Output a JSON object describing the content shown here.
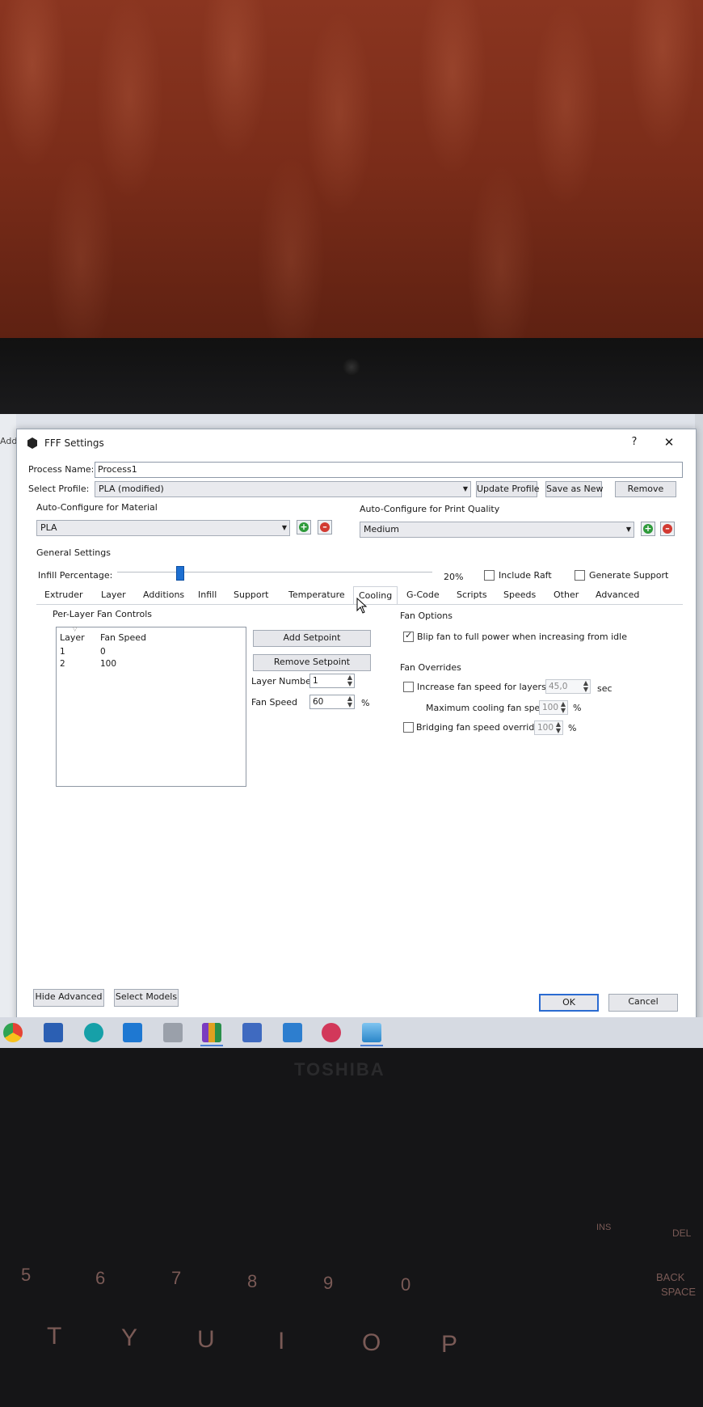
{
  "dialog": {
    "title": "FFF Settings",
    "help": "?",
    "close": "✕",
    "process_name_label": "Process Name:",
    "process_name_value": "Process1",
    "select_profile_label": "Select Profile:",
    "profile_value": "PLA (modified)",
    "update_profile": "Update Profile",
    "save_as_new": "Save as New",
    "remove": "Remove",
    "auto_material_label": "Auto-Configure for Material",
    "material_value": "PLA",
    "auto_quality_label": "Auto-Configure for Print Quality",
    "quality_value": "Medium",
    "general_settings": "General Settings",
    "infill_label": "Infill Percentage:",
    "infill_value": "20%",
    "infill_fraction": 0.2,
    "include_raft": "Include Raft",
    "generate_support": "Generate Support",
    "tabs": [
      "Extruder",
      "Layer",
      "Additions",
      "Infill",
      "Support",
      "Temperature",
      "Cooling",
      "G-Code",
      "Scripts",
      "Speeds",
      "Other",
      "Advanced"
    ],
    "active_tab": "Cooling",
    "per_layer_title": "Per-Layer Fan Controls",
    "table_headers": {
      "layer": "Layer",
      "fan_speed": "Fan Speed"
    },
    "rows": [
      {
        "layer": "1",
        "fan_speed": "0"
      },
      {
        "layer": "2",
        "fan_speed": "100"
      }
    ],
    "add_setpoint": "Add Setpoint",
    "remove_setpoint": "Remove Setpoint",
    "layer_number_label": "Layer Number",
    "layer_number_value": "1",
    "fan_speed_label": "Fan Speed",
    "fan_speed_value": "60",
    "percent": "%",
    "fan_options_title": "Fan Options",
    "blip_fan": "Blip fan to full power when increasing from idle",
    "fan_overrides_title": "Fan Overrides",
    "increase_fan_label": "Increase fan speed for layers below",
    "increase_fan_value": "45,0",
    "sec": "sec",
    "max_cooling_label": "Maximum cooling fan speed",
    "max_cooling_value": "100",
    "bridging_label": "Bridging fan speed override",
    "bridging_value": "100",
    "hide_advanced": "Hide Advanced",
    "select_models": "Select Models",
    "ok": "OK",
    "cancel": "Cancel"
  },
  "behind_window_text": "Add-",
  "laptop": {
    "brand": "TOSHIBA",
    "keys_row1": [
      "5",
      "6",
      "7",
      "8",
      "9",
      "0",
      "BACK",
      "SPACE"
    ],
    "keys_row2": [
      "T",
      "Y",
      "U",
      "I",
      "O",
      "P"
    ],
    "keys_top": [
      "INS",
      "DEL"
    ]
  },
  "colors": {
    "accent": "#1d6fd1",
    "wall": "#7a2c19",
    "ok_border": "#2a6bd1"
  }
}
